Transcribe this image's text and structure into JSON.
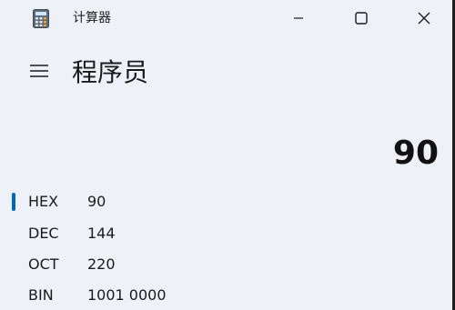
{
  "window": {
    "title": "计算器",
    "icons": {
      "app": "calculator-icon",
      "minimize": "minimize-icon",
      "maximize": "maximize-icon",
      "close": "close-icon"
    }
  },
  "header": {
    "menu_icon": "hamburger-menu-icon",
    "mode_title": "程序员"
  },
  "display": {
    "value": "90"
  },
  "radix_list": {
    "selected": "HEX",
    "items": [
      {
        "label": "HEX",
        "value": "90"
      },
      {
        "label": "DEC",
        "value": "144"
      },
      {
        "label": "OCT",
        "value": "220"
      },
      {
        "label": "BIN",
        "value": "1001 0000"
      }
    ]
  },
  "colors": {
    "background": "#eef2f8",
    "accent": "#0067c0",
    "text": "#1a1a1a"
  }
}
